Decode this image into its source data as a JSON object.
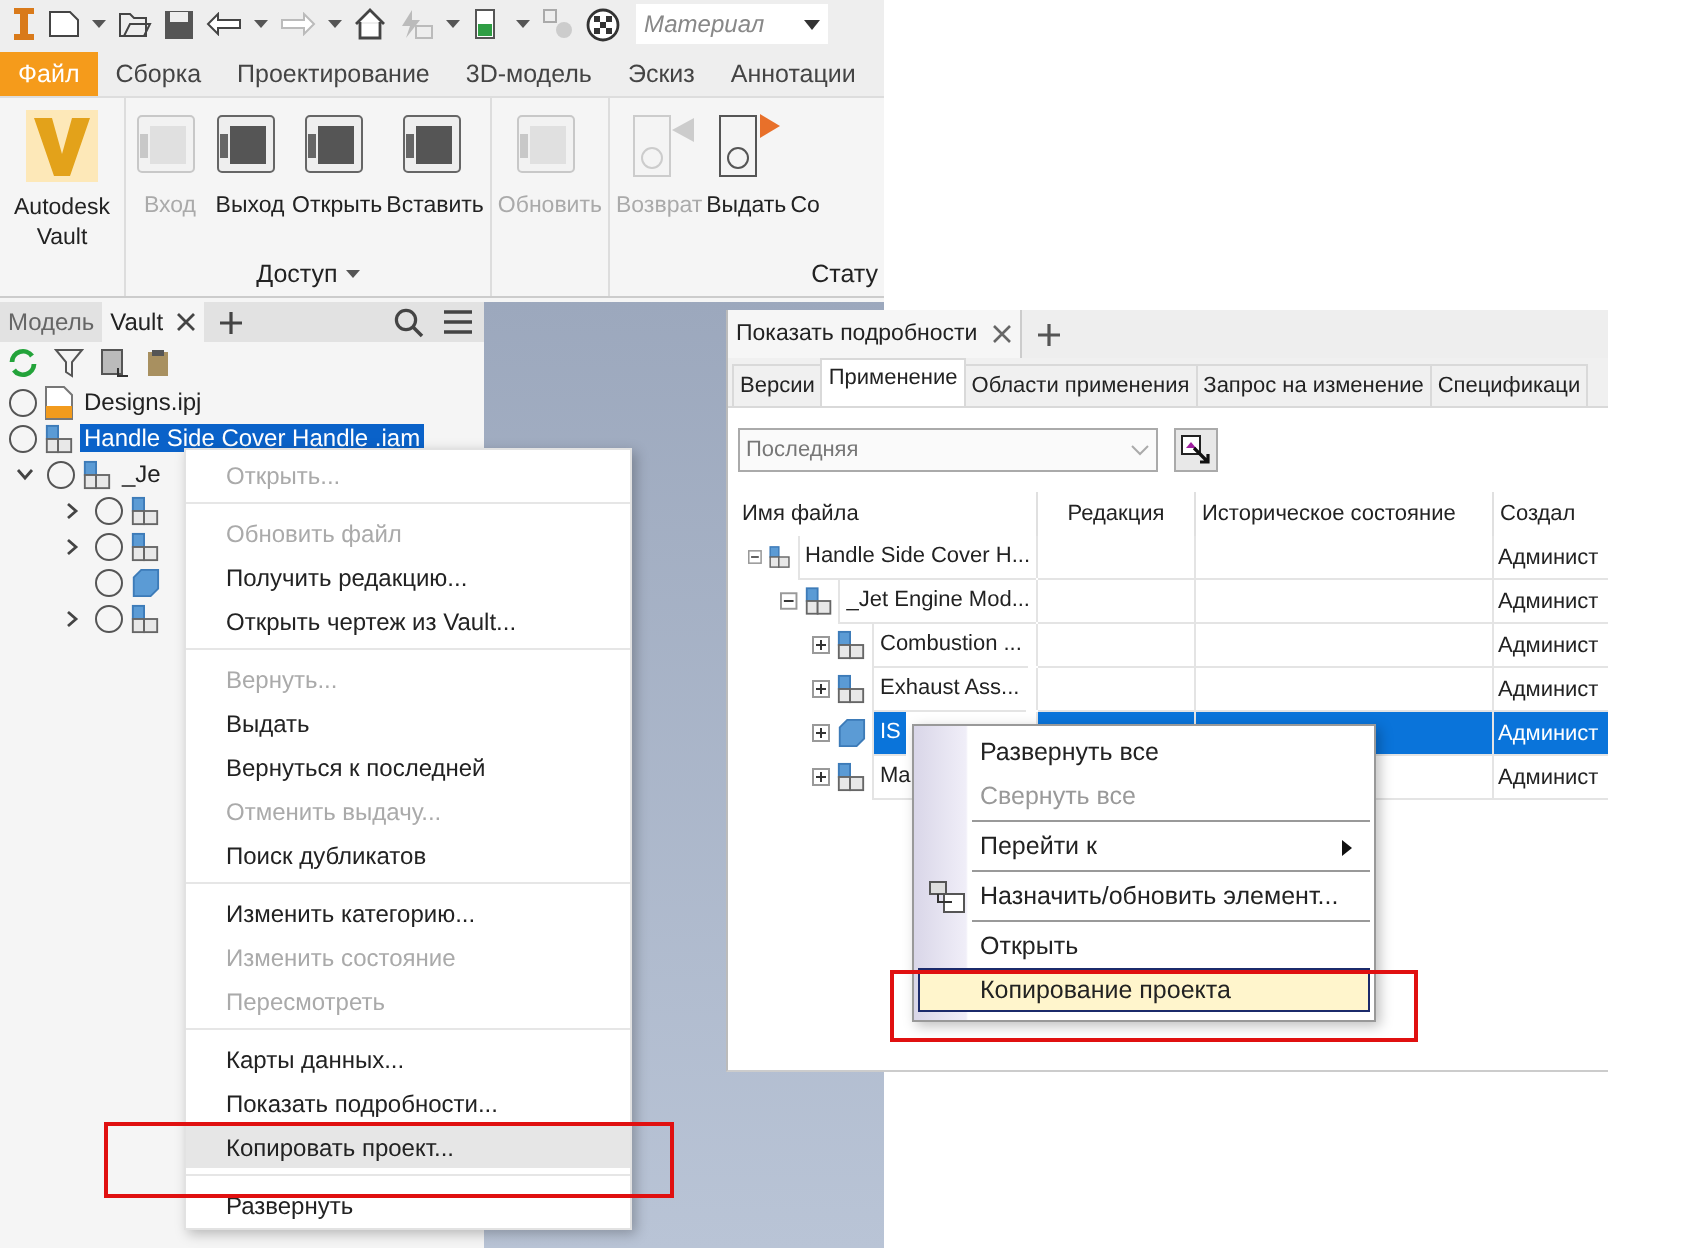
{
  "quick_access": {
    "material": {
      "placeholder": "Материал"
    }
  },
  "ribbon": {
    "tabs": [
      {
        "label": "Файл",
        "selected": true
      },
      {
        "label": "Сборка",
        "selected": false
      },
      {
        "label": "Проектирование",
        "selected": false
      },
      {
        "label": "3D-модель",
        "selected": false
      },
      {
        "label": "Эскиз",
        "selected": false
      },
      {
        "label": "Аннотации",
        "selected": false
      }
    ],
    "groups": [
      {
        "buttons": [
          {
            "kind": "vault",
            "label": "Autodesk Vault",
            "disabled": false
          }
        ]
      },
      {
        "label": "Доступ",
        "buttons": [
          {
            "kind": "login",
            "label": "Вход",
            "disabled": true
          },
          {
            "kind": "logout",
            "label": "Выход",
            "disabled": false
          },
          {
            "kind": "open",
            "label": "Открыть",
            "disabled": false
          },
          {
            "kind": "insert",
            "label": "Вставить",
            "disabled": false
          }
        ]
      },
      {
        "buttons": [
          {
            "kind": "refresh",
            "label": "Обновить",
            "disabled": true
          }
        ]
      },
      {
        "label": "Стату",
        "buttons": [
          {
            "kind": "checkin",
            "label": "Возврат",
            "disabled": true
          },
          {
            "kind": "checkout",
            "label": "Выдать",
            "disabled": false
          },
          {
            "kind": "cut",
            "label": "Со",
            "disabled": false
          }
        ]
      }
    ]
  },
  "browser": {
    "tabs": [
      {
        "label": "Модель",
        "selected": false,
        "closable": false
      },
      {
        "label": "Vault",
        "selected": true,
        "closable": true
      }
    ],
    "tree": [
      {
        "kind": "project",
        "label": "Designs.ipj",
        "selected": false
      },
      {
        "kind": "assembly",
        "label": "Handle Side Cover Handle .iam",
        "selected": true
      },
      {
        "kind": "assembly",
        "label": "_Je",
        "selected": false,
        "expanded": true,
        "children": [
          {
            "kind": "assembly",
            "expanded": false
          },
          {
            "kind": "assembly",
            "expanded": false
          },
          {
            "kind": "part"
          },
          {
            "kind": "assembly",
            "expanded": false
          }
        ]
      }
    ]
  },
  "context_menu": {
    "sections": [
      {
        "items": [
          {
            "label": "Открыть...",
            "disabled": true,
            "selected": false
          }
        ]
      },
      {
        "items": [
          {
            "label": "Обновить файл",
            "disabled": true,
            "selected": false
          },
          {
            "label": "Получить редакцию...",
            "disabled": false,
            "selected": false
          },
          {
            "label": "Открыть чертеж из Vault...",
            "disabled": false,
            "selected": false
          }
        ]
      },
      {
        "items": [
          {
            "label": "Вернуть...",
            "disabled": true,
            "selected": false
          },
          {
            "label": "Выдать",
            "disabled": false,
            "selected": false
          },
          {
            "label": "Вернуться к последней",
            "disabled": false,
            "selected": false
          },
          {
            "label": "Отменить выдачу...",
            "disabled": true,
            "selected": false
          },
          {
            "label": "Поиск дубликатов",
            "disabled": false,
            "selected": false
          }
        ]
      },
      {
        "items": [
          {
            "label": "Изменить категорию...",
            "disabled": false,
            "selected": false
          },
          {
            "label": "Изменить состояние",
            "disabled": true,
            "selected": false
          },
          {
            "label": "Пересмотреть",
            "disabled": true,
            "selected": false
          }
        ]
      },
      {
        "items": [
          {
            "label": "Карты данных...",
            "disabled": false,
            "selected": false
          },
          {
            "label": "Показать подробности...",
            "disabled": false,
            "selected": false
          },
          {
            "label": "Копировать проект...",
            "disabled": false,
            "selected": true
          }
        ]
      },
      {
        "items": [
          {
            "label": "Развернуть",
            "disabled": false,
            "selected": false
          }
        ]
      }
    ]
  },
  "details": {
    "title": "Показать подробности",
    "tabs": [
      {
        "label": "Версии",
        "selected": false
      },
      {
        "label": "Применение",
        "selected": true
      },
      {
        "label": "Области применения",
        "selected": false
      },
      {
        "label": "Запрос на изменение",
        "selected": false
      },
      {
        "label": "Спецификаци",
        "selected": false
      }
    ],
    "version_select": {
      "value": "Последняя",
      "disabled": true
    },
    "table": {
      "columns": [
        "Имя файла",
        "Редакция",
        "Историческое состояние",
        "Создал"
      ],
      "rows": [
        {
          "kind": "assembly",
          "name": "Handle Side Cover H...",
          "created_by": "Админист",
          "expanded": true,
          "selected": false,
          "children": [
            {
              "kind": "assembly",
              "name": "_Jet Engine Mod...",
              "created_by": "Админист",
              "expanded": true,
              "selected": false,
              "children": [
                {
                  "kind": "assembly",
                  "name": "Combustion ...",
                  "created_by": "Админист",
                  "expanded": false,
                  "selected": false
                },
                {
                  "kind": "assembly",
                  "name": "Exhaust Ass...",
                  "created_by": "Админист",
                  "expanded": false,
                  "selected": false
                },
                {
                  "kind": "part",
                  "name": "IS",
                  "created_by": "Админист",
                  "expanded": false,
                  "selected": true
                },
                {
                  "kind": "assembly",
                  "name": "Ma",
                  "created_by": "Админист",
                  "expanded": false,
                  "selected": false
                }
              ]
            }
          ]
        }
      ]
    },
    "context_menu": {
      "sections": [
        {
          "items": [
            {
              "label": "Развернуть все",
              "disabled": false,
              "selected": false,
              "submenu": false
            },
            {
              "label": "Свернуть все",
              "disabled": true,
              "selected": false,
              "submenu": false
            }
          ]
        },
        {
          "items": [
            {
              "label": "Перейти к",
              "disabled": false,
              "selected": false,
              "submenu": true
            }
          ]
        },
        {
          "items": [
            {
              "label": "Назначить/обновить элемент...",
              "disabled": false,
              "selected": false,
              "submenu": false,
              "icon": true
            }
          ]
        },
        {
          "items": [
            {
              "label": "Открыть",
              "disabled": false,
              "selected": false,
              "submenu": false
            },
            {
              "label": "Копирование проекта",
              "disabled": false,
              "selected": true,
              "submenu": false
            }
          ]
        }
      ]
    }
  }
}
